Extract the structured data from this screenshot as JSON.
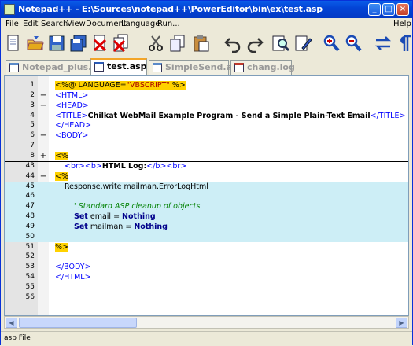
{
  "window": {
    "title": "Notepad++ - E:\\Sources\\notepad++\\PowerEditor\\bin\\ex\\test.asp"
  },
  "menu": [
    {
      "id": "file",
      "label": "File"
    },
    {
      "id": "edit",
      "label": "Edit"
    },
    {
      "id": "search",
      "label": "Search"
    },
    {
      "id": "view",
      "label": "View"
    },
    {
      "id": "document",
      "label": "Document"
    },
    {
      "id": "language",
      "label": "Language"
    },
    {
      "id": "run",
      "label": "Run..."
    },
    {
      "id": "help",
      "label": "Help"
    }
  ],
  "toolbar_icons": [
    "new-file-icon",
    "open-file-icon",
    "save-icon",
    "save-all-icon",
    "close-icon",
    "close-all-icon",
    "cut-icon",
    "copy-icon",
    "paste-icon",
    "undo-icon",
    "redo-icon",
    "find-icon",
    "replace-icon",
    "zoom-in-icon",
    "zoom-out-icon",
    "sync-scroll-icon",
    "show-all-characters-icon"
  ],
  "tabs": [
    {
      "label": "Notepad_plus.rc",
      "active": false
    },
    {
      "label": "test.asp",
      "active": true
    },
    {
      "label": "SimpleSend.asp",
      "active": false
    },
    {
      "label": "chang.log",
      "active": false
    }
  ],
  "lines": [
    {
      "n": "1",
      "fold": "",
      "hl": false,
      "sep": false,
      "indent": 0,
      "tokens": [
        {
          "t": "<%@ LANGUAGE=",
          "c": "asp"
        },
        {
          "t": "\"VBSCRIPT\"",
          "c": "str"
        },
        {
          "t": " %>",
          "c": "asp"
        }
      ]
    },
    {
      "n": "2",
      "fold": "−",
      "hl": false,
      "sep": false,
      "indent": 0,
      "tokens": [
        {
          "t": "<HTML>",
          "c": "tag"
        }
      ]
    },
    {
      "n": "3",
      "fold": "−",
      "hl": false,
      "sep": false,
      "indent": 0,
      "tokens": [
        {
          "t": "<HEAD>",
          "c": "tag"
        }
      ]
    },
    {
      "n": "4",
      "fold": "",
      "hl": false,
      "sep": false,
      "indent": 0,
      "tokens": [
        {
          "t": "<TITLE>",
          "c": "tag"
        },
        {
          "t": "Chilkat WebMail Example Program - Send a Simple Plain-Text Email",
          "c": "txt"
        },
        {
          "t": "</TITLE>",
          "c": "tag"
        }
      ]
    },
    {
      "n": "5",
      "fold": "",
      "hl": false,
      "sep": false,
      "indent": 0,
      "tokens": [
        {
          "t": "</HEAD>",
          "c": "tag"
        }
      ]
    },
    {
      "n": "6",
      "fold": "−",
      "hl": false,
      "sep": false,
      "indent": 0,
      "tokens": [
        {
          "t": "<BODY>",
          "c": "tag"
        }
      ]
    },
    {
      "n": "7",
      "fold": "",
      "hl": false,
      "sep": false,
      "indent": 0,
      "tokens": []
    },
    {
      "n": "8",
      "fold": "+",
      "hl": false,
      "sep": true,
      "indent": 0,
      "tokens": [
        {
          "t": "<%",
          "c": "asp"
        }
      ]
    },
    {
      "n": "43",
      "fold": "",
      "hl": false,
      "sep": false,
      "indent": 1,
      "tokens": [
        {
          "t": "<br>",
          "c": "tag"
        },
        {
          "t": "<b>",
          "c": "tag"
        },
        {
          "t": "HTML Log:",
          "c": "txt"
        },
        {
          "t": "</b>",
          "c": "tag"
        },
        {
          "t": "<br>",
          "c": "tag"
        }
      ]
    },
    {
      "n": "44",
      "fold": "−",
      "hl": false,
      "sep": false,
      "indent": 0,
      "tokens": [
        {
          "t": "<%",
          "c": "asp"
        }
      ]
    },
    {
      "n": "45",
      "fold": "",
      "hl": true,
      "sep": false,
      "indent": 1,
      "tokens": [
        {
          "t": "Response.write mailman.ErrorLogHtml",
          "c": "plain"
        }
      ]
    },
    {
      "n": "46",
      "fold": "",
      "hl": true,
      "sep": false,
      "indent": 0,
      "tokens": []
    },
    {
      "n": "47",
      "fold": "",
      "hl": true,
      "sep": false,
      "indent": 2,
      "tokens": [
        {
          "t": "' Standard ASP cleanup of objects",
          "c": "cmt"
        }
      ]
    },
    {
      "n": "48",
      "fold": "",
      "hl": true,
      "sep": false,
      "indent": 2,
      "tokens": [
        {
          "t": "Set",
          "c": "kw"
        },
        {
          "t": " email = ",
          "c": "plain"
        },
        {
          "t": "Nothing",
          "c": "kw"
        }
      ]
    },
    {
      "n": "49",
      "fold": "",
      "hl": true,
      "sep": false,
      "indent": 2,
      "tokens": [
        {
          "t": "Set",
          "c": "kw"
        },
        {
          "t": " mailman = ",
          "c": "plain"
        },
        {
          "t": "Nothing",
          "c": "kw"
        }
      ]
    },
    {
      "n": "50",
      "fold": "",
      "hl": true,
      "sep": false,
      "indent": 0,
      "tokens": []
    },
    {
      "n": "51",
      "fold": "",
      "hl": false,
      "sep": false,
      "indent": 0,
      "tokens": [
        {
          "t": "%>",
          "c": "asp"
        }
      ]
    },
    {
      "n": "52",
      "fold": "",
      "hl": false,
      "sep": false,
      "indent": 0,
      "tokens": []
    },
    {
      "n": "53",
      "fold": "",
      "hl": false,
      "sep": false,
      "indent": 0,
      "tokens": [
        {
          "t": "</BODY>",
          "c": "tag"
        }
      ]
    },
    {
      "n": "54",
      "fold": "",
      "hl": false,
      "sep": false,
      "indent": 0,
      "tokens": [
        {
          "t": "</HTML>",
          "c": "tag"
        }
      ]
    },
    {
      "n": "55",
      "fold": "",
      "hl": false,
      "sep": false,
      "indent": 0,
      "tokens": []
    },
    {
      "n": "56",
      "fold": "",
      "hl": false,
      "sep": false,
      "indent": 0,
      "tokens": []
    }
  ],
  "status": {
    "text": "asp File"
  }
}
